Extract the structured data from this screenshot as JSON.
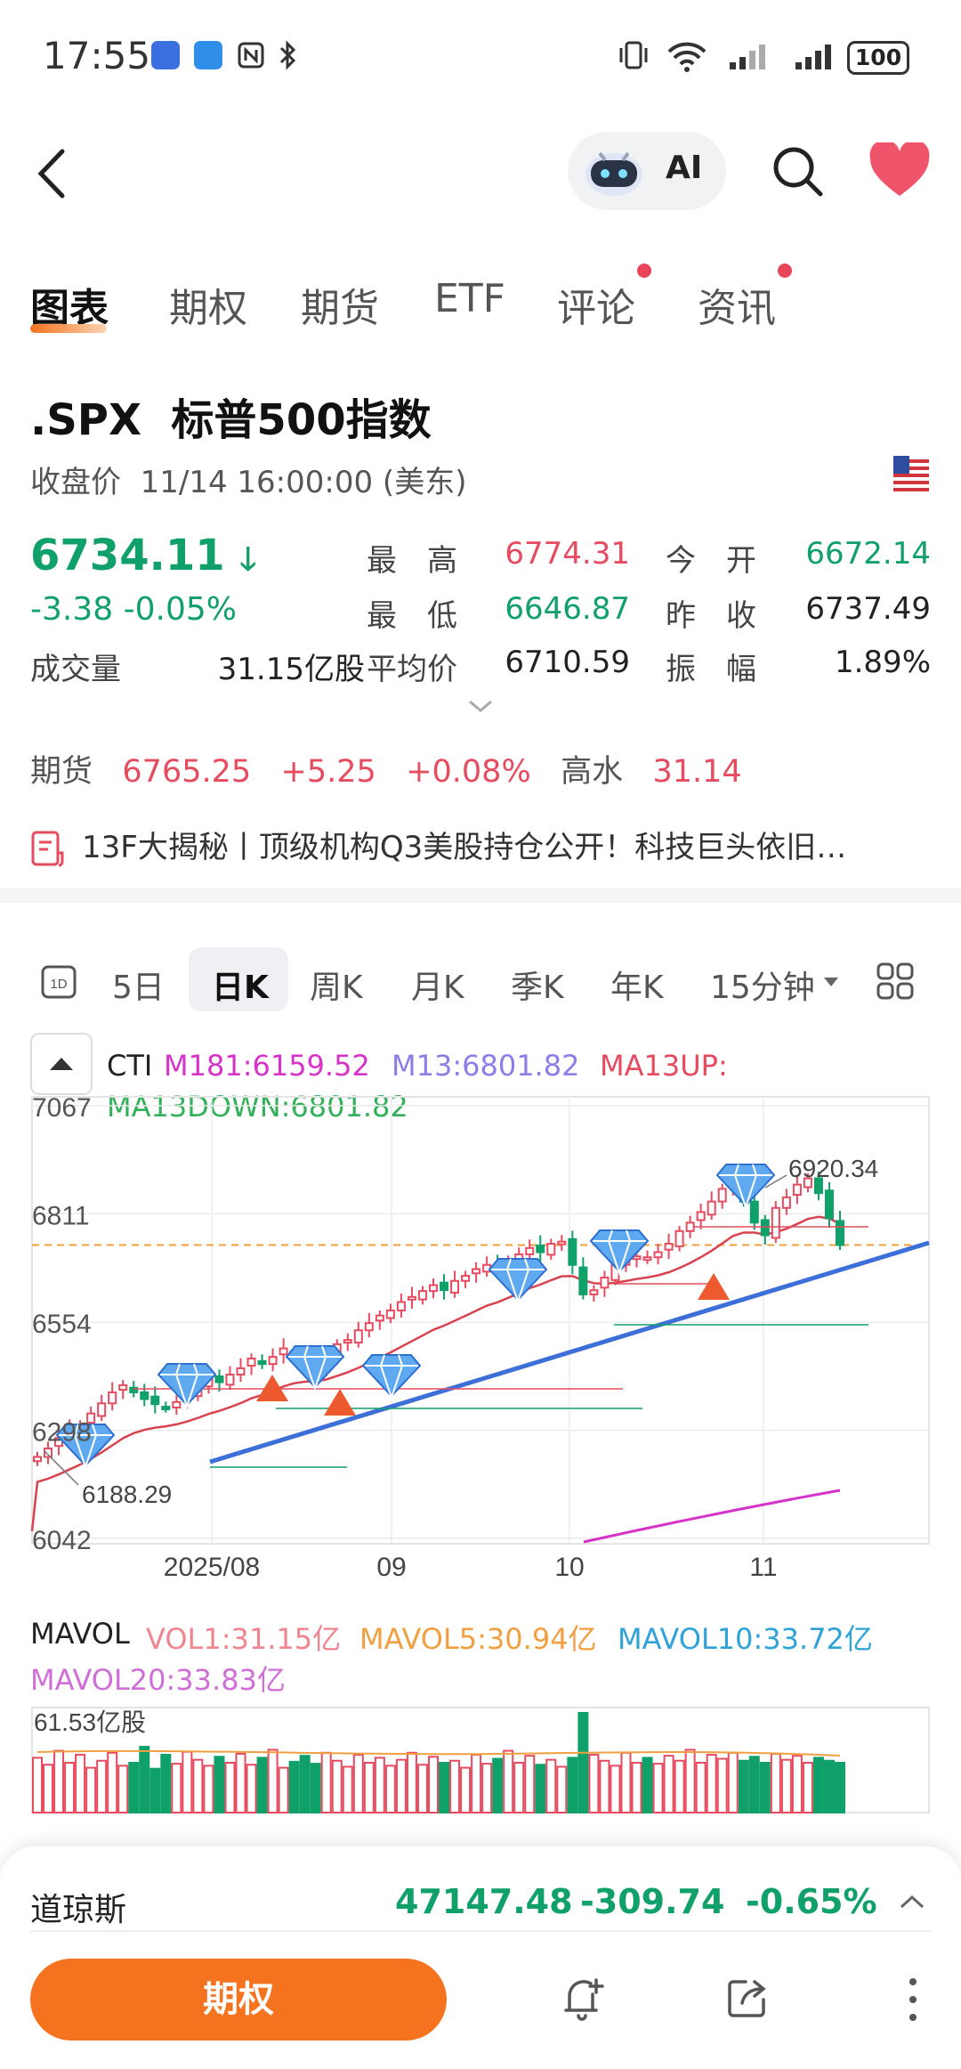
{
  "status_bar": {
    "time": "17:55",
    "battery": "100"
  },
  "header": {
    "ai_label": "AI"
  },
  "tabs": [
    {
      "label": "图表",
      "active": true,
      "dot": false
    },
    {
      "label": "期权",
      "active": false,
      "dot": false
    },
    {
      "label": "期货",
      "active": false,
      "dot": false
    },
    {
      "label": "ETF",
      "active": false,
      "dot": false
    },
    {
      "label": "评论",
      "active": false,
      "dot": true
    },
    {
      "label": "资讯",
      "active": false,
      "dot": true
    }
  ],
  "quote": {
    "symbol": ".SPX",
    "name": "标普500指数",
    "close_label": "收盘价",
    "close_time": "11/14 16:00:00 (美东)",
    "price": "6734.11",
    "change": "-3.38",
    "change_pct": "-0.05%",
    "volume_label": "成交量",
    "volume": "31.15亿股",
    "high_label": "最　高",
    "high": "6774.31",
    "low_label": "最　低",
    "low": "6646.87",
    "avg_label": "平均价",
    "avg": "6710.59",
    "open_label": "今　开",
    "open": "6672.14",
    "prev_label": "昨　收",
    "prev": "6737.49",
    "amp_label": "振　幅",
    "amp": "1.89%"
  },
  "futures": {
    "label": "期货",
    "price": "6765.25",
    "change": "+5.25",
    "change_pct": "+0.08%",
    "premium_label": "高水",
    "premium": "31.14"
  },
  "news": {
    "text": "13F大揭秘丨顶级机构Q3美股持仓公开！科技巨头依旧…"
  },
  "period_tabs": [
    {
      "label": "5日",
      "active": false
    },
    {
      "label": "日K",
      "active": true
    },
    {
      "label": "周K",
      "active": false
    },
    {
      "label": "月K",
      "active": false
    },
    {
      "label": "季K",
      "active": false
    },
    {
      "label": "年K",
      "active": false
    },
    {
      "label": "15分钟",
      "active": false
    }
  ],
  "indicators": {
    "cti": "CTI",
    "m181": "M181:6159.52",
    "m13": "M13:6801.82",
    "ma13up": "MA13UP:",
    "ma13down": "MA13DOWN:6801.82"
  },
  "chart_data": {
    "type": "line",
    "y_ticks": [
      "7067",
      "6811",
      "6554",
      "6298",
      "6042"
    ],
    "x_ticks": [
      "2025/08",
      "09",
      "10",
      "11"
    ],
    "annotations": [
      "6920.34",
      "6188.29"
    ],
    "ylim": [
      6042,
      7067
    ],
    "reference_line": 6737,
    "colors": {
      "up": "#e64b5f",
      "down": "#10a06a",
      "ma13": "#d9434f",
      "trend": "#3d6fd8",
      "m181": "#d633c8",
      "ref": "#f0a040"
    },
    "close": [
      6235,
      6255,
      6280,
      6300,
      6310,
      6338,
      6362,
      6388,
      6405,
      6388,
      6372,
      6360,
      6352,
      6365,
      6385,
      6402,
      6420,
      6412,
      6430,
      6445,
      6468,
      6455,
      6472,
      6492,
      6480,
      6460,
      6444,
      6470,
      6502,
      6512,
      6535,
      6552,
      6570,
      6582,
      6602,
      6614,
      6628,
      6642,
      6630,
      6652,
      6664,
      6680,
      6690,
      6674,
      6700,
      6715,
      6730,
      6720,
      6740,
      6745,
      6690,
      6620,
      6630,
      6660,
      6690,
      6700,
      6710,
      6708,
      6720,
      6740,
      6770,
      6790,
      6815,
      6840,
      6870,
      6890,
      6840,
      6790,
      6760,
      6825,
      6850,
      6880,
      6895,
      6860,
      6800,
      6737
    ]
  },
  "volume": {
    "title": "MAVOL",
    "vol1": "VOL1:31.15亿",
    "mavol5": "MAVOL5:30.94亿",
    "mavol10": "MAVOL10:33.72亿",
    "mavol20": "MAVOL20:33.83亿",
    "max_label": "61.53亿股",
    "values": [
      0.55,
      0.48,
      0.62,
      0.5,
      0.58,
      0.45,
      0.52,
      0.6,
      0.47,
      0.5,
      0.66,
      0.44,
      0.58,
      0.49,
      0.61,
      0.53,
      0.47,
      0.56,
      0.5,
      0.59,
      0.48,
      0.55,
      0.63,
      0.45,
      0.51,
      0.57,
      0.49,
      0.6,
      0.52,
      0.46,
      0.58,
      0.5,
      0.55,
      0.47,
      0.53,
      0.6,
      0.48,
      0.56,
      0.5,
      0.52,
      0.45,
      0.58,
      0.49,
      0.54,
      0.62,
      0.5,
      0.57,
      0.48,
      0.53,
      0.46,
      0.55,
      1.0,
      0.58,
      0.52,
      0.47,
      0.6,
      0.5,
      0.55,
      0.49,
      0.57,
      0.52,
      0.63,
      0.5,
      0.58,
      0.54,
      0.6,
      0.52,
      0.56,
      0.5,
      0.59,
      0.53,
      0.57,
      0.5,
      0.55,
      0.52,
      0.5
    ]
  },
  "ticker": {
    "name": "道琼斯",
    "price": "47147.48",
    "change": "-309.74",
    "change_pct": "-0.65%"
  },
  "bottom_bar": {
    "options_label": "期权"
  }
}
